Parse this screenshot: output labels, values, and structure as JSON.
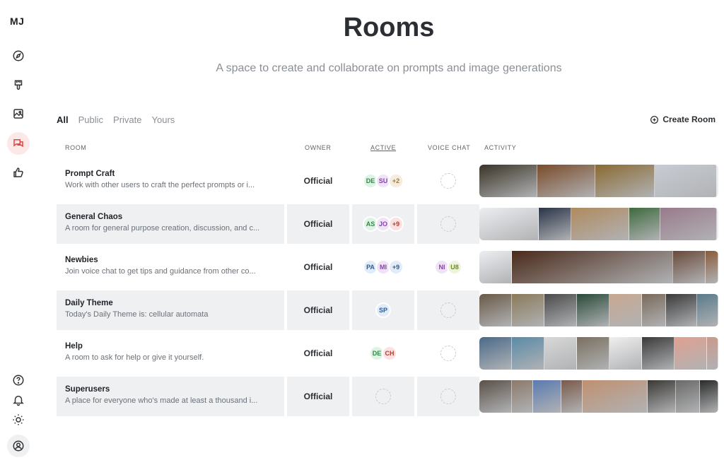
{
  "app": {
    "logo": "MJ"
  },
  "sidebar": {
    "items": [
      {
        "icon": "compass-icon",
        "active": false
      },
      {
        "icon": "brush-icon",
        "active": false
      },
      {
        "icon": "image-icon",
        "active": false
      },
      {
        "icon": "chat-icon",
        "active": true
      },
      {
        "icon": "thumbs-up-icon",
        "active": false
      }
    ],
    "bottom": [
      {
        "icon": "help-icon"
      },
      {
        "icon": "bell-icon"
      },
      {
        "icon": "sun-icon"
      },
      {
        "icon": "user-icon"
      }
    ]
  },
  "header": {
    "title": "Rooms",
    "subtitle": "A space to create and collaborate on prompts and image generations"
  },
  "filters": [
    "All",
    "Public",
    "Private",
    "Yours"
  ],
  "active_filter": "All",
  "create_room_label": "Create Room",
  "columns": {
    "room": "ROOM",
    "owner": "OWNER",
    "active": "ACTIVE",
    "voice_chat": "VOICE CHAT",
    "activity": "ACTIVITY"
  },
  "colors": {
    "accent": "#e04545",
    "row_shade": "#eef0f2",
    "avatar_green": "#dff3e4",
    "avatar_purple": "#efe3f6",
    "avatar_blue": "#e1ecf8",
    "avatar_tan": "#f6ecdc",
    "avatar_pink": "#fbe1e1"
  },
  "rooms": [
    {
      "name": "Prompt Craft",
      "desc": "Work with other users to craft the perfect prompts or i...",
      "owner": "Official",
      "active": [
        {
          "text": "DE",
          "bg": "#dff3e4",
          "fg": "#2f8a4a"
        },
        {
          "text": "SU",
          "bg": "#efe3f6",
          "fg": "#8a3fb0"
        },
        {
          "text": "+2",
          "bg": "#f6ecdc",
          "fg": "#9a7a45"
        }
      ],
      "voice": [],
      "activity": [
        {
          "w": 82,
          "c": "#3a3326"
        },
        {
          "w": 82,
          "c": "#7a4b2a"
        },
        {
          "w": 84,
          "c": "#8a6a32"
        },
        {
          "w": 88,
          "c": "#c8ccd4"
        }
      ]
    },
    {
      "name": "General Chaos",
      "desc": "A room for general purpose creation, discussion, and c...",
      "owner": "Official",
      "active": [
        {
          "text": "AS",
          "bg": "#dff3e4",
          "fg": "#2f8a4a"
        },
        {
          "text": "JO",
          "bg": "#efe3f6",
          "fg": "#8a3fb0"
        },
        {
          "text": "+9",
          "bg": "#fbe1e1",
          "fg": "#c0392b"
        }
      ],
      "voice": [],
      "activity": [
        {
          "w": 84,
          "c": "#eceef1"
        },
        {
          "w": 46,
          "c": "#2a3448"
        },
        {
          "w": 82,
          "c": "#b08a5e"
        },
        {
          "w": 44,
          "c": "#3f6a3e"
        },
        {
          "w": 80,
          "c": "#9a7a8c"
        }
      ]
    },
    {
      "name": "Newbies",
      "desc": "Join voice chat to get tips and guidance from other co...",
      "owner": "Official",
      "active": [
        {
          "text": "PA",
          "bg": "#e1ecf8",
          "fg": "#2c5d9a"
        },
        {
          "text": "MI",
          "bg": "#efe3f6",
          "fg": "#8a3fb0"
        },
        {
          "text": "+9",
          "bg": "#e1ecf8",
          "fg": "#2c5d9a"
        }
      ],
      "voice": [
        {
          "text": "NI",
          "bg": "#efe3f6",
          "fg": "#8a3fb0"
        },
        {
          "text": "U8",
          "bg": "#eef3dc",
          "fg": "#6a8a2a"
        }
      ],
      "activity": [
        {
          "w": 46,
          "c": "#eceef1"
        },
        {
          "w": 228,
          "c": "#4a2a1a"
        },
        {
          "w": 46,
          "c": "#6a4a3a"
        },
        {
          "w": 18,
          "c": "#8a5a3a"
        }
      ]
    },
    {
      "name": "Daily Theme",
      "desc": "Today's Daily Theme is: cellular automata",
      "owner": "Official",
      "active": [
        {
          "text": "SP",
          "bg": "#e1ecf8",
          "fg": "#2c5d9a"
        }
      ],
      "voice": [],
      "activity": [
        {
          "w": 46,
          "c": "#6a5a48"
        },
        {
          "w": 46,
          "c": "#8a7a5a"
        },
        {
          "w": 46,
          "c": "#4a4a4a"
        },
        {
          "w": 46,
          "c": "#2a4a3a"
        },
        {
          "w": 46,
          "c": "#c8a890"
        },
        {
          "w": 34,
          "c": "#7a6a5a"
        },
        {
          "w": 44,
          "c": "#3a3a3a"
        },
        {
          "w": 30,
          "c": "#5a7a8a"
        }
      ]
    },
    {
      "name": "Help",
      "desc": "A room to ask for help or give it yourself.",
      "owner": "Official",
      "active": [
        {
          "text": "DE",
          "bg": "#dff3e4",
          "fg": "#2f8a4a"
        },
        {
          "text": "CH",
          "bg": "#fbe1e1",
          "fg": "#c0392b"
        }
      ],
      "voice": [],
      "activity": [
        {
          "w": 46,
          "c": "#4a6a8a"
        },
        {
          "w": 46,
          "c": "#5a8aa8"
        },
        {
          "w": 46,
          "c": "#d8d8d8"
        },
        {
          "w": 46,
          "c": "#7a7060"
        },
        {
          "w": 46,
          "c": "#efefef"
        },
        {
          "w": 46,
          "c": "#3a3a3a"
        },
        {
          "w": 46,
          "c": "#e0a090"
        },
        {
          "w": 16,
          "c": "#c89a8a"
        }
      ]
    },
    {
      "name": "Superusers",
      "desc": "A place for everyone who's made at least a thousand i...",
      "owner": "Official",
      "active": [],
      "voice": [],
      "activity": [
        {
          "w": 46,
          "c": "#5a5048"
        },
        {
          "w": 30,
          "c": "#8a7a6a"
        },
        {
          "w": 40,
          "c": "#5a7ab0"
        },
        {
          "w": 30,
          "c": "#7a5a4a"
        },
        {
          "w": 92,
          "c": "#c09070"
        },
        {
          "w": 40,
          "c": "#3a3834"
        },
        {
          "w": 34,
          "c": "#6a6a68"
        },
        {
          "w": 26,
          "c": "#2a2a2a"
        }
      ]
    }
  ]
}
